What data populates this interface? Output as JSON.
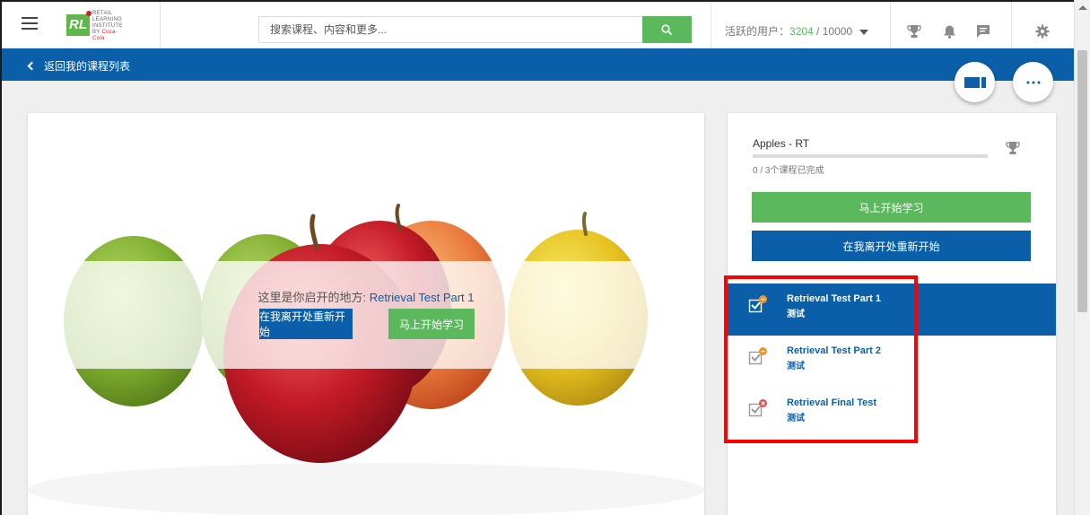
{
  "header": {
    "logo_text": [
      "RETAIL",
      "LEARNING",
      "INSTITUTE",
      "BY",
      "Coca-Cola"
    ],
    "logo_mark": "RL",
    "search_placeholder": "搜索课程、内容和更多...",
    "active_users_label": "活跃的用户：",
    "active_users_count": "3204",
    "active_users_total": " / 10000",
    "icons": [
      "trophy-icon",
      "bell-icon",
      "chat-icon",
      "gear-icon"
    ]
  },
  "nav": {
    "back_label": "返回我的课程列表"
  },
  "hero": {
    "resume_prefix": "这里是你启开的地方: ",
    "resume_course": "Retrieval Test Part 1",
    "restart_button": "在我离开处重新开始",
    "start_button": "马上开始学习"
  },
  "side": {
    "course_title": "Apples - RT",
    "progress_text": "0 / 3个课程已完成",
    "progress_fraction": 0,
    "start_button": "马上开始学习",
    "restart_button": "在我离开处重新开始",
    "lessons": [
      {
        "name": "Retrieval Test Part 1",
        "type": "测试",
        "status": "in-progress",
        "active": true
      },
      {
        "name": "Retrieval Test Part 2",
        "type": "测试",
        "status": "in-progress",
        "active": false
      },
      {
        "name": "Retrieval Final Test",
        "type": "测试",
        "status": "failed",
        "active": false
      }
    ]
  },
  "colors": {
    "brand_blue": "#0a5fa8",
    "accent_green": "#5cb85c",
    "highlight_red": "#ff0000",
    "status_orange": "#e8952c",
    "status_red": "#d9534f"
  }
}
